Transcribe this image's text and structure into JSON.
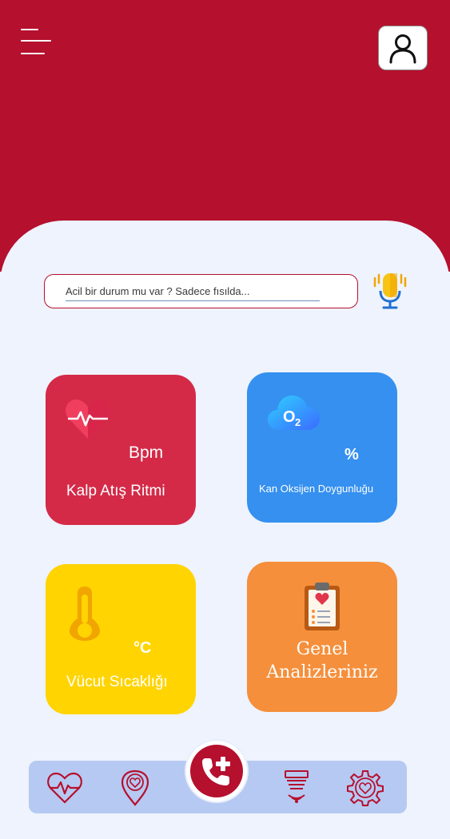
{
  "header": {
    "menu_icon": "hamburger-menu-icon",
    "profile_icon": "user-profile-icon",
    "background_color": "#b5102e"
  },
  "search": {
    "placeholder": "Acil bir durum mu var ? Sadece fısılda...",
    "value": "",
    "voice_icon": "microphone-icon"
  },
  "cards": {
    "heart_rate": {
      "unit": "Bpm",
      "label": "Kalp Atış Ritmi",
      "icon": "heartbeat-icon",
      "color": "#d42a48"
    },
    "oxygen": {
      "unit": "%",
      "label": "Kan Oksijen Doygunluğu",
      "icon": "o2-cloud-icon",
      "color": "#3590f0"
    },
    "temperature": {
      "unit": "°C",
      "label": "Vücut Sıcaklığı",
      "icon": "thermometer-icon",
      "color": "#ffd400"
    },
    "analysis": {
      "label_line1": "Genel",
      "label_line2": "Analizleriniz",
      "icon": "clipboard-heart-icon",
      "color": "#f58f3b"
    }
  },
  "bottom_nav": {
    "items": [
      {
        "name": "heart-monitor",
        "icon": "heart-pulse-icon"
      },
      {
        "name": "location",
        "icon": "heart-location-pin-icon"
      },
      {
        "name": "emergency-call",
        "icon": "phone-plus-icon"
      },
      {
        "name": "sensor",
        "icon": "wireless-sensor-icon"
      },
      {
        "name": "settings",
        "icon": "heart-gear-icon"
      }
    ],
    "background_color": "#b6c9f2"
  }
}
